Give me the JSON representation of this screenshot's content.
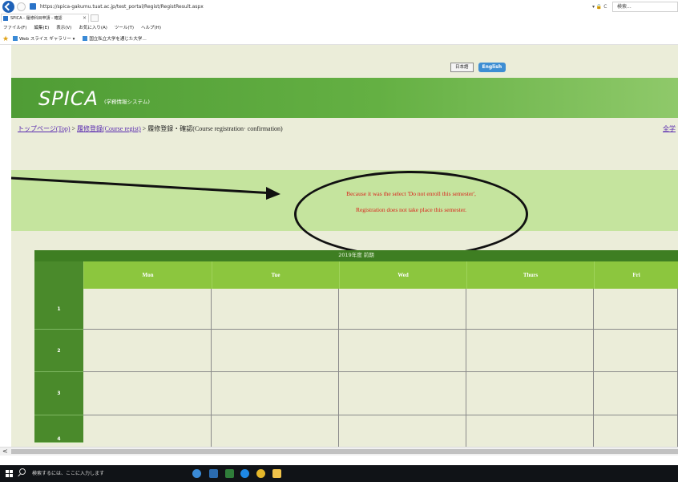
{
  "browser": {
    "url": "https://spica-gakumu.tuat.ac.jp/test_portal/Regist/RegistResult.aspx",
    "refresh_controls": "▾ 🔒 C",
    "search_placeholder": "検索...",
    "tab_title": "SPICA - 履修科目申請 - 確認",
    "tab_close": "×",
    "menu": [
      "ファイル(F)",
      "編集(E)",
      "表示(V)",
      "お気に入り(A)",
      "ツール(T)",
      "ヘルプ(H)"
    ],
    "favorites": [
      "Web スライス ギャラリー ▾",
      "国立私立大学を通じた大学…"
    ]
  },
  "page": {
    "lang_ja": "日本語",
    "lang_en": "English",
    "logo": "SPICA",
    "logo_sub": "(学務情報システム)",
    "breadcrumb": {
      "top": "トップページ(Top)",
      "sep1": " > ",
      "course": "履修登録(Course regist)",
      "sep2": " > ",
      "current": "履修登録・確認(Course registration· confirmation)"
    },
    "breadcrumb_right": "全学",
    "message": {
      "line1": "Because it was the select 'Do not enroll this semester',",
      "line2": "Registration does not take place this semester."
    },
    "timetable": {
      "title": "2019年度 前期",
      "days": [
        "Mon",
        "Tue",
        "Wed",
        "Thurs",
        "Fri"
      ],
      "periods": [
        "1",
        "2",
        "3",
        "4"
      ]
    }
  },
  "scrollbar": {
    "left_arrow": "<"
  },
  "taskbar": {
    "search_text": "検索するには、ここに入力します"
  },
  "colors": {
    "banner_green": "#5aa43c",
    "message_panel": "#c5e49e",
    "message_text": "#d9231b",
    "header_green": "#8cc63e",
    "period_green": "#4a8a2b",
    "page_bg": "#ebedd9",
    "english_button": "#3d8ed3"
  }
}
